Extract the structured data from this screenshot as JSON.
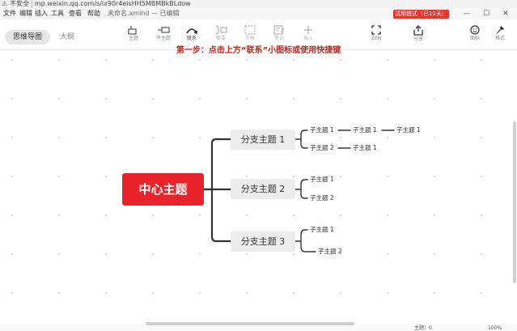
{
  "browser": {
    "security": "不安全",
    "url": "mp.weixin.qq.com/s/ix90r4eisHH5MBMBkBLdow"
  },
  "menu": {
    "items": [
      "文件",
      "编辑",
      "插入",
      "工具",
      "查看",
      "帮助"
    ],
    "filename": "未命名.xmind — 已编辑",
    "trial_badge": "试用模式（已11天）"
  },
  "window": {
    "minimize": "—",
    "maximize": "☐",
    "close": "✕"
  },
  "view_tabs": {
    "mindmap": "思维导图",
    "outline": "大纲"
  },
  "toolbar": {
    "topic": "主题",
    "subtopic": "子主题",
    "relationship": "联系",
    "summary": "概要",
    "boundary": "外框",
    "note": "笔记",
    "insert": "插入",
    "zen": "ZEN",
    "share": "分享",
    "icon": "图标",
    "format": "格式"
  },
  "tip": "第一步：点击上方“联系”小图标或使用快捷键",
  "colors": {
    "center": "#e8232b",
    "tip": "#c0271d",
    "trial": "#e8362d",
    "branch_bg": "#ececec"
  },
  "mindmap": {
    "center": "中心主题",
    "branches": [
      {
        "label": "分支主题 1",
        "subtopics": [
          "子主题 1",
          "子主题 1",
          "子主题 1",
          "子主题 2",
          "子主题 1"
        ]
      },
      {
        "label": "分支主题 2",
        "subtopics": [
          "子主题 1",
          "子主题 2"
        ]
      },
      {
        "label": "分支主题 3",
        "subtopics": [
          "子主题 1",
          "子主题 2"
        ]
      }
    ]
  },
  "status": {
    "topics": "主题：0",
    "zoom": "100%"
  }
}
